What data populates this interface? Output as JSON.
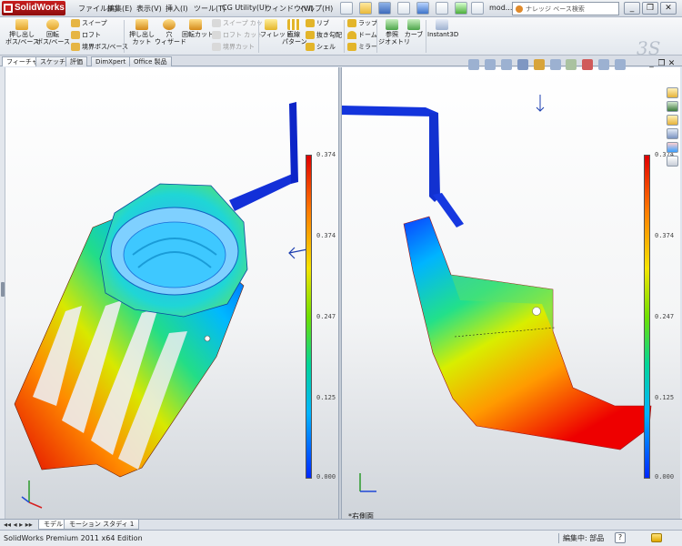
{
  "app": {
    "title": "SolidWorks",
    "document": "mod..."
  },
  "menu": [
    "ファイル(F)",
    "編集(E)",
    "表示(V)",
    "挿入(I)",
    "ツール(T)",
    "CG Utility(U)",
    "ウィンドウ(W)",
    "ヘルプ(H)"
  ],
  "search": {
    "placeholder": "ナレッジ ベース検索"
  },
  "window_buttons": {
    "minimize": "_",
    "restore": "❐",
    "close": "✕"
  },
  "commands": {
    "extrude_boss": "押し出し\nボス/ベース",
    "revolve_boss": "回転\nボス/ベース",
    "sweep": "スイープ",
    "loft": "ロフト",
    "boundary_boss": "境界ボス/ベース",
    "extrude_cut": "押し出し\nカット",
    "hole_wizard": "穴\nウィザード",
    "revolve_cut": "回転カット",
    "swept_cut": "スイープ カット",
    "lofted_cut": "ロフト カット",
    "boundary_cut": "境界カット",
    "fillet": "フィレット",
    "linear_pattern": "直線\nパターン",
    "rib": "リブ",
    "draft": "抜き勾配",
    "shell": "シェル",
    "wrap": "ラップ",
    "dome": "ドーム",
    "mirror": "ミラー",
    "ref_geometry": "参照\nジオメトリ",
    "curves": "カーブ",
    "instant3d": "Instant3D"
  },
  "tabs": [
    "フィーチャー",
    "スケッチ",
    "評価",
    "DimXpert",
    "Office 製品"
  ],
  "legend": {
    "ticks": [
      "0.374",
      "0.374",
      "0.247",
      "0.125",
      "0.000"
    ]
  },
  "view_label": "*右側面",
  "bottom_tabs": [
    "モデル",
    "モーション スタディ 1"
  ],
  "bottom_nav": "◂◂ ◂ ▸ ▸▸",
  "status": {
    "edition": "SolidWorks Premium 2011 x64 Edition",
    "mode": "編集中: 部品",
    "help": "?"
  },
  "icons": {
    "save": "save-icon",
    "undo": "undo-icon",
    "new": "new-document-icon",
    "open": "open-icon",
    "print": "print-icon",
    "rebuild": "rebuild-icon",
    "select": "select-icon",
    "options": "options-icon"
  }
}
